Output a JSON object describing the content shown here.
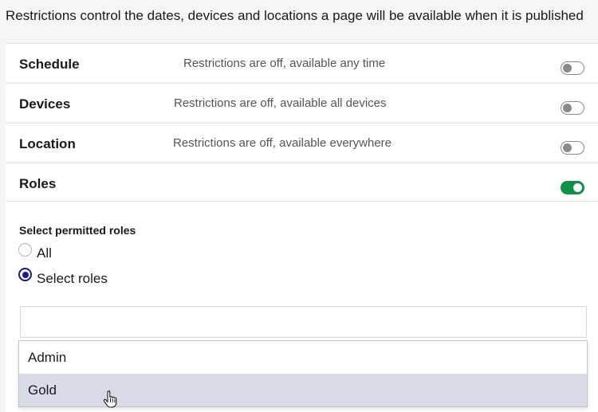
{
  "intro": "Restrictions control the dates, devices and locations a page will be available when it is published",
  "restrictions": [
    {
      "title": "Schedule",
      "status": "Restrictions are off, available any time",
      "enabled": false
    },
    {
      "title": "Devices",
      "status": "Restrictions are off, available all devices",
      "enabled": false
    },
    {
      "title": "Location",
      "status": "Restrictions are off, available everywhere",
      "enabled": false
    },
    {
      "title": "Roles",
      "status": "",
      "enabled": true
    }
  ],
  "roles": {
    "section_label": "Select permitted roles",
    "options": [
      {
        "label": "All",
        "selected": false
      },
      {
        "label": "Select roles",
        "selected": true
      }
    ],
    "search_value": "",
    "dropdown_items": [
      {
        "label": "Admin",
        "highlighted": false
      },
      {
        "label": "Gold",
        "highlighted": true
      }
    ]
  },
  "colors": {
    "toggle_on": "#0e9247",
    "toggle_off": "#8a8a8a",
    "radio_selected": "#1c1a8c",
    "option_highlight": "#d8dbe8"
  },
  "icons": {
    "cursor": "hand-pointer-icon"
  }
}
